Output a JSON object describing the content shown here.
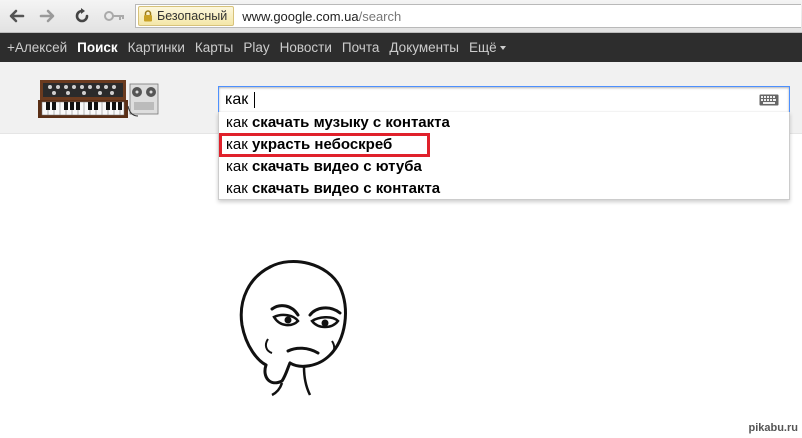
{
  "browser": {
    "security_label": "Безопасный",
    "url_host": "www.google.com.ua",
    "url_path": "/search"
  },
  "gbar": {
    "items": [
      "+Алексей",
      "Поиск",
      "Картинки",
      "Карты",
      "Play",
      "Новости",
      "Почта",
      "Документы"
    ],
    "more_label": "Ещё"
  },
  "search": {
    "query": "как"
  },
  "suggestions": [
    {
      "prefix": "как",
      "rest": "скачать музыку с контакта"
    },
    {
      "prefix": "как",
      "rest": "украсть небоскреб"
    },
    {
      "prefix": "как",
      "rest": "скачать видео с ютуба"
    },
    {
      "prefix": "как",
      "rest": "скачать видео с контакта"
    }
  ],
  "watermark": "pikabu.ru",
  "colors": {
    "highlight_border": "#e0212b",
    "gbar_bg": "#2d2d2d",
    "focus_border": "#4d90fe"
  }
}
